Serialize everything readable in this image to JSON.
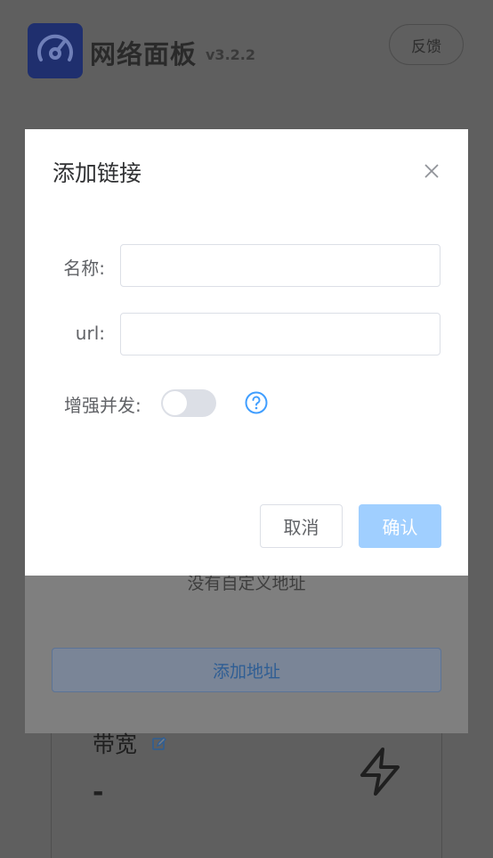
{
  "header": {
    "app_title": "网络面板",
    "version": "v3.2.2",
    "feedback_label": "反馈"
  },
  "background": {
    "empty_text": "没有自定义地址",
    "add_address_label": "添加地址",
    "bandwidth_title": "带宽",
    "bandwidth_value": "-"
  },
  "dialog": {
    "title": "添加链接",
    "fields": {
      "name_label": "名称:",
      "name_value": "",
      "url_label": "url:",
      "url_value": "",
      "boost_label": "增强并发:",
      "boost_enabled": false
    },
    "cancel_label": "取消",
    "confirm_label": "确认"
  },
  "colors": {
    "primary": "#409eff",
    "primary_disabled": "#a0cfff",
    "overlay_bg": "#5f5f5f"
  },
  "icons": {
    "logo": "speedometer-icon",
    "close": "close-icon",
    "help": "question-circle-icon",
    "edit": "edit-icon",
    "bolt": "lightning-bolt-icon"
  }
}
